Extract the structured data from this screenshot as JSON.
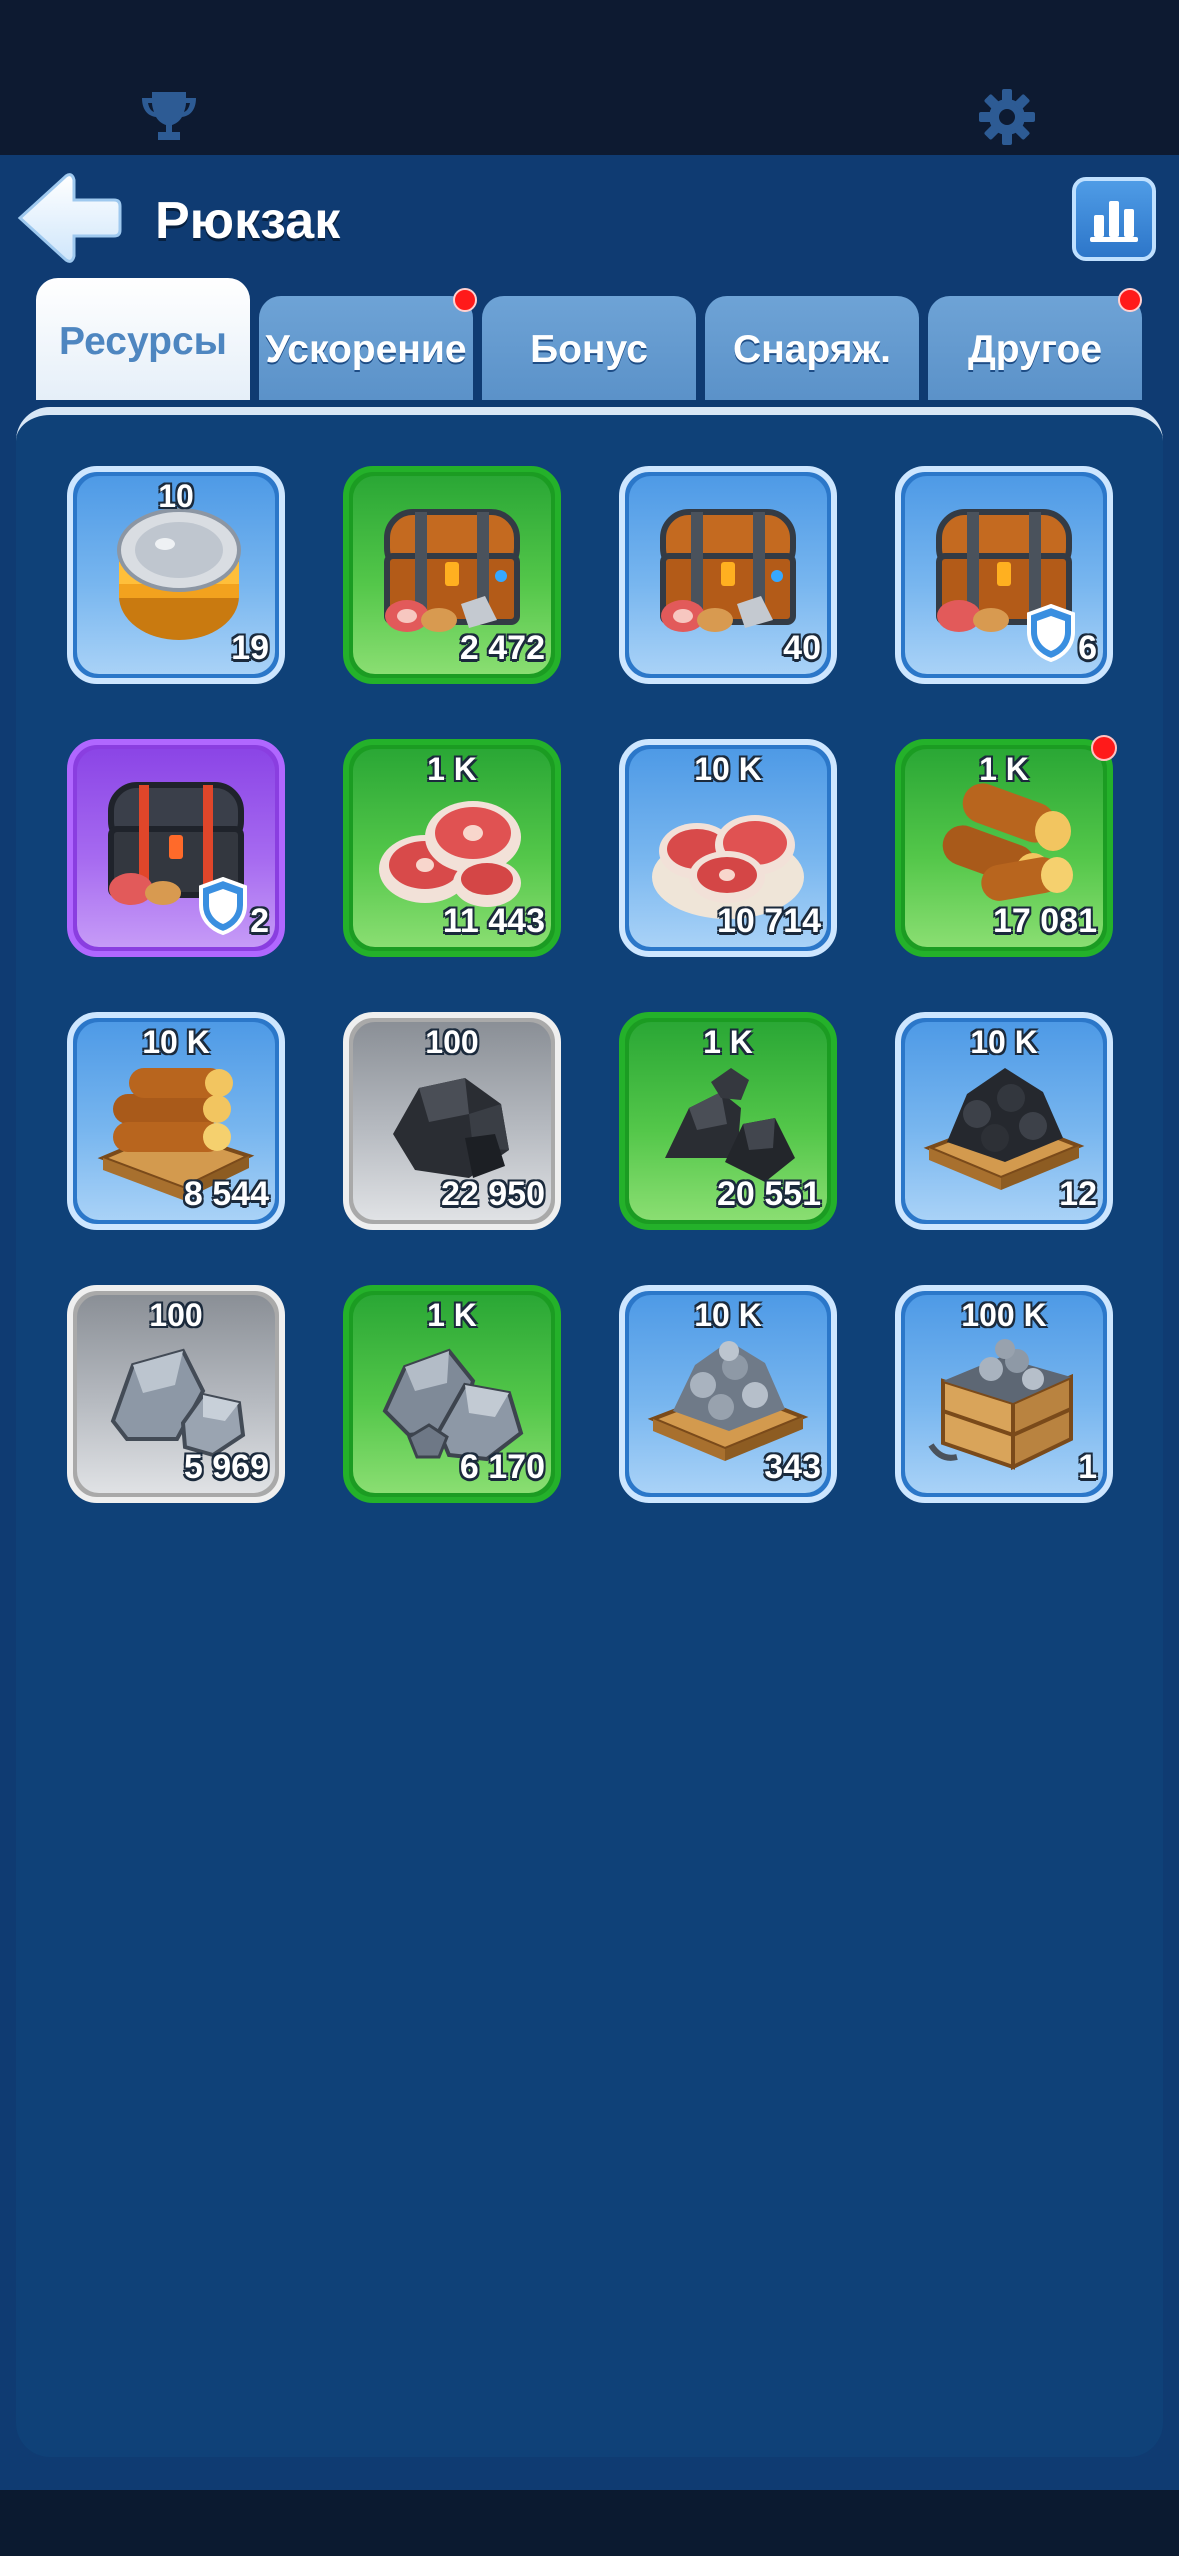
{
  "header": {
    "title": "Рюкзак"
  },
  "tabs": [
    {
      "label": "Ресурсы",
      "active": true,
      "notification": false
    },
    {
      "label": "Ускорение",
      "active": false,
      "notification": true
    },
    {
      "label": "Бонус",
      "active": false,
      "notification": false
    },
    {
      "label": "Снаряж.",
      "active": false,
      "notification": false
    },
    {
      "label": "Другое",
      "active": false,
      "notification": true
    }
  ],
  "items": [
    {
      "icon": "tin-can-icon",
      "quality": "blue",
      "tier": "10",
      "count": "19"
    },
    {
      "icon": "resource-chest-icon",
      "quality": "green",
      "tier": "",
      "count": "2 472"
    },
    {
      "icon": "resource-chest-icon",
      "quality": "blue",
      "tier": "",
      "count": "40"
    },
    {
      "icon": "protected-resource-chest-icon",
      "quality": "blue",
      "tier": "",
      "count": "6"
    },
    {
      "icon": "protected-epic-chest-icon",
      "quality": "purple",
      "tier": "",
      "count": "2"
    },
    {
      "icon": "meat-icon",
      "quality": "green",
      "tier": "1 K",
      "count": "11 443"
    },
    {
      "icon": "meat-plate-icon",
      "quality": "blue",
      "tier": "10 K",
      "count": "10 714"
    },
    {
      "icon": "wood-logs-icon",
      "quality": "green",
      "tier": "1 K",
      "count": "17 081",
      "notification": true
    },
    {
      "icon": "wood-pallet-icon",
      "quality": "blue",
      "tier": "10 K",
      "count": "8 544"
    },
    {
      "icon": "coal-icon",
      "quality": "gray",
      "tier": "100",
      "count": "22 950"
    },
    {
      "icon": "coal-pile-icon",
      "quality": "green",
      "tier": "1 K",
      "count": "20 551"
    },
    {
      "icon": "coal-pallet-icon",
      "quality": "blue",
      "tier": "10 K",
      "count": "12"
    },
    {
      "icon": "iron-ore-icon",
      "quality": "gray",
      "tier": "100",
      "count": "5 969"
    },
    {
      "icon": "iron-ore-pile-icon",
      "quality": "green",
      "tier": "1 K",
      "count": "6 170"
    },
    {
      "icon": "iron-pallet-icon",
      "quality": "blue",
      "tier": "10 K",
      "count": "343"
    },
    {
      "icon": "iron-crate-icon",
      "quality": "blue",
      "tier": "100 K",
      "count": "1"
    }
  ],
  "colors": {
    "background": "#0f4178",
    "header": "#0f3b72",
    "notification": "#ff1a1a",
    "quality_blue": "#4e9ae6",
    "quality_green": "#54c74a",
    "quality_gray": "#b7bbc1",
    "quality_purple": "#a66af0"
  }
}
